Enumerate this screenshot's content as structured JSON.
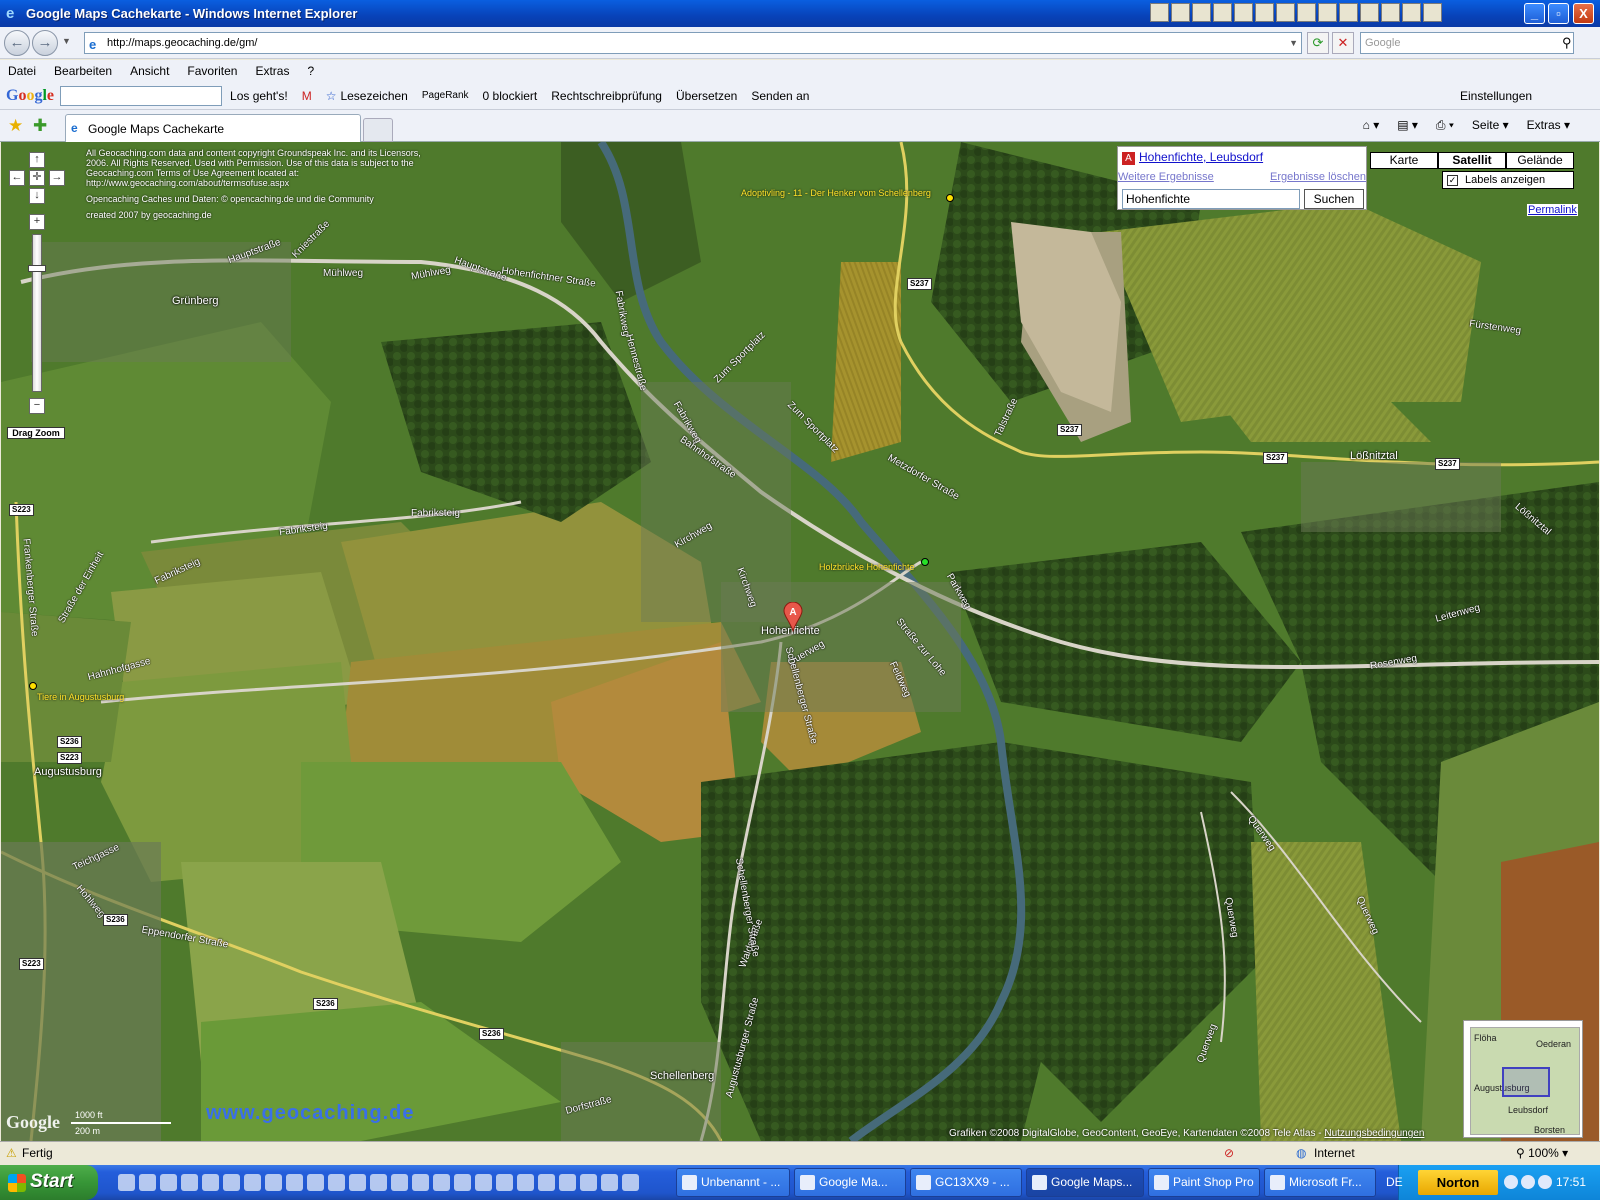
{
  "window": {
    "title": "Google Maps Cachekarte - Windows Internet Explorer",
    "controls": {
      "minimize": "_",
      "maximize": "▫",
      "close": "X"
    }
  },
  "address": {
    "url": "http://maps.geocaching.de/gm/",
    "search_placeholder": "Google"
  },
  "menu": [
    "Datei",
    "Bearbeiten",
    "Ansicht",
    "Favoriten",
    "Extras",
    "?"
  ],
  "google_toolbar": {
    "logo": "Google",
    "go": "Los geht's!",
    "bookmarks": "Lesezeichen",
    "pagerank": "PageRank",
    "blocked": "0 blockiert",
    "spellcheck": "Rechtschreibprüfung",
    "translate": "Übersetzen",
    "send": "Senden an",
    "settings": "Einstellungen"
  },
  "tabs": {
    "active": "Google Maps Cachekarte",
    "tools": {
      "page": "Seite",
      "extras": "Extras"
    }
  },
  "map": {
    "copyright_lines": [
      "All Geocaching.com data and content copyright Groundspeak Inc. and its Licensors, 2006. All Rights Reserved. Used with Permission. Use of this data is subject to the Geocaching.com Terms of Use Agreement located at: http://www.geocaching.com/about/termsofuse.aspx",
      "Opencaching Caches und Daten: © opencaching.de und die Community",
      "created 2007 by geocaching.de"
    ],
    "drag_zoom": "Drag Zoom",
    "result": {
      "marker": "A",
      "link": "Hohenfichte, Leubsdorf",
      "more": "Weitere Ergebnisse",
      "clear": "Ergebnisse löschen",
      "query": "Hohenfichte",
      "search_button": "Suchen"
    },
    "map_types": {
      "map": "Karte",
      "satellite": "Satellit",
      "terrain": "Gelände",
      "active": "Satellit"
    },
    "labels_toggle": {
      "label": "Labels anzeigen",
      "checked": true
    },
    "permalink": "Permalink",
    "places": {
      "grunberg": "Grünberg",
      "augustusburg": "Augustusburg",
      "hohenfichte": "Hohenfichte",
      "lossnitztal": "Lößnitztal",
      "schellenberg": "Schellenberg"
    },
    "streets": {
      "hauptstrasse": "Hauptstraße",
      "muehlweg": "Mühlweg",
      "hohenfichtner": "Hohenfichtner Straße",
      "kniestrasse": "Kniestraße",
      "fabriksteig": "Fabriksteig",
      "fabrikweg": "Fabrikweg",
      "bahnhofstrasse": "Bahnhofstraße",
      "zum_sportplatz": "Zum Sportplatz",
      "metzdorfer": "Metzdorfer Straße",
      "kirchweg": "Kirchweg",
      "querweg": "Querweg",
      "schellenberger": "Schellenberger Straße",
      "strasse_zur_lohe": "Straße zur Lohe",
      "feldweg": "Feldweg",
      "talstrasse": "Talstraße",
      "fuerstenweg": "Fürstenweg",
      "leitenweg": "Leitenweg",
      "rosenweg": "Rosenweg",
      "eppendorfer": "Eppendorfer Straße",
      "dorfstrasse": "Dorfstraße",
      "waldstrasse": "Waldstraße",
      "frankenberger": "Frankenberger Straße",
      "strasse_der_einheit": "Straße der Einheit",
      "hahnhofgasse": "Hahnhofgasse",
      "teichgasse": "Teichgasse",
      "hohlweg": "Hohlweg",
      "lossnitztal_road": "Lößnitztal",
      "henneweg": "Hennestraße",
      "parkweg": "Parkweg",
      "augustusburger": "Augustusburger Straße"
    },
    "shields": {
      "s237": "S237",
      "s223": "S223",
      "s236": "S236"
    },
    "caches": {
      "adoptivling": "Adoptivling - 11 - Der Henker vom Schellenberg",
      "holzbruecke": "Holzbrücke Hohenfichte",
      "tiere": "Tiere in Augustusburg"
    },
    "overview": {
      "floeha": "Flöha",
      "oederan": "Oederan",
      "augustusburg": "Augustusburg",
      "leubsdorf": "Leubsdorf",
      "borstendorf": "Borsten"
    },
    "scale": {
      "ft": "1000 ft",
      "m": "200 m"
    },
    "watermark": "www.geocaching.de",
    "google_logo": "Google",
    "attribution": "Grafiken ©2008 DigitalGlobe, GeoContent, GeoEye, Kartendaten ©2008 Tele Atlas -",
    "terms": "Nutzungsbedingungen"
  },
  "status": {
    "text": "Fertig",
    "zone": "Internet",
    "zoom": "100%"
  },
  "taskbar": {
    "start": "Start",
    "tasks": [
      {
        "label": "Unbenannt - ...",
        "active": false
      },
      {
        "label": "Google Ma...",
        "active": false
      },
      {
        "label": "GC13XX9 - ...",
        "active": false
      },
      {
        "label": "Google Maps...",
        "active": true
      },
      {
        "label": "Paint Shop Pro",
        "active": false
      },
      {
        "label": "Microsoft Fr...",
        "active": false
      }
    ],
    "lang": "DE",
    "norton": "Norton",
    "clock": "17:51"
  }
}
